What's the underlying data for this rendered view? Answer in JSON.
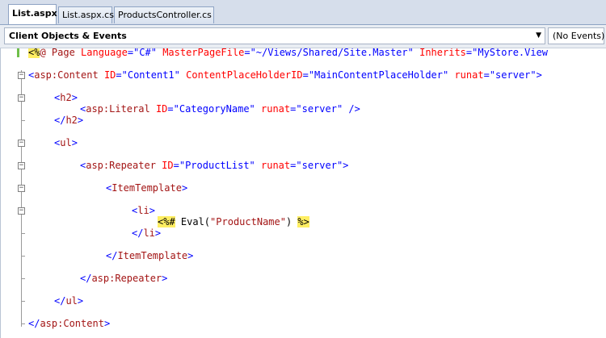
{
  "tabs": [
    {
      "label": "List.aspx",
      "active": true
    },
    {
      "label": "List.aspx.cs",
      "active": false
    },
    {
      "label": "ProductsController.cs",
      "active": false
    }
  ],
  "object_dropdown": {
    "value": "Client Objects & Events",
    "arrow": "▼"
  },
  "event_dropdown": {
    "value": "(No Events)"
  },
  "fold_glyph": "−",
  "code": {
    "l1": {
      "open": "<%",
      "rest_a": "@ ",
      "page": "Page ",
      "a1": "Language",
      "v1": "=\"C#\" ",
      "a2": "MasterPageFile",
      "v2": "=\"~/Views/Shared/Site.Master\" ",
      "a3": "Inherits",
      "v3": "=\"MyStore.View"
    },
    "l2": {
      "lt": "<",
      "el": "asp:Content",
      "a1": " ID",
      "v1": "=\"Content1\"",
      "a2": " ContentPlaceHolderID",
      "v2": "=\"MainContentPlaceHolder\"",
      "a3": " runat",
      "v3": "=\"server\">"
    },
    "l3": {
      "lt": "<",
      "el": "h2",
      "gt": ">"
    },
    "l4": {
      "lt": "<",
      "el": "asp:Literal",
      "a1": " ID",
      "v1": "=\"CategoryName\"",
      "a2": " runat",
      "v2": "=\"server\"",
      "gt": " />"
    },
    "l5": {
      "lt": "</",
      "el": "h2",
      "gt": ">"
    },
    "l6": {
      "lt": "<",
      "el": "ul",
      "gt": ">"
    },
    "l7": {
      "lt": "<",
      "el": "asp:Repeater",
      "a1": " ID",
      "v1": "=\"ProductList\"",
      "a2": " runat",
      "v2": "=\"server\">"
    },
    "l8": {
      "lt": "<",
      "el": "ItemTemplate",
      "gt": ">"
    },
    "l9": {
      "lt": "<",
      "el": "li",
      "gt": ">"
    },
    "l10": {
      "open": "<%#",
      "mid": " Eval(",
      "str": "\"ProductName\"",
      "end": ") ",
      "close": "%>"
    },
    "l11": {
      "lt": "</",
      "el": "li",
      "gt": ">"
    },
    "l12": {
      "lt": "</",
      "el": "ItemTemplate",
      "gt": ">"
    },
    "l13": {
      "lt": "</",
      "el": "asp:Repeater",
      "gt": ">"
    },
    "l14": {
      "lt": "</",
      "el": "ul",
      "gt": ">"
    },
    "l15": {
      "lt": "</",
      "el": "asp:Content",
      "gt": ">"
    }
  }
}
